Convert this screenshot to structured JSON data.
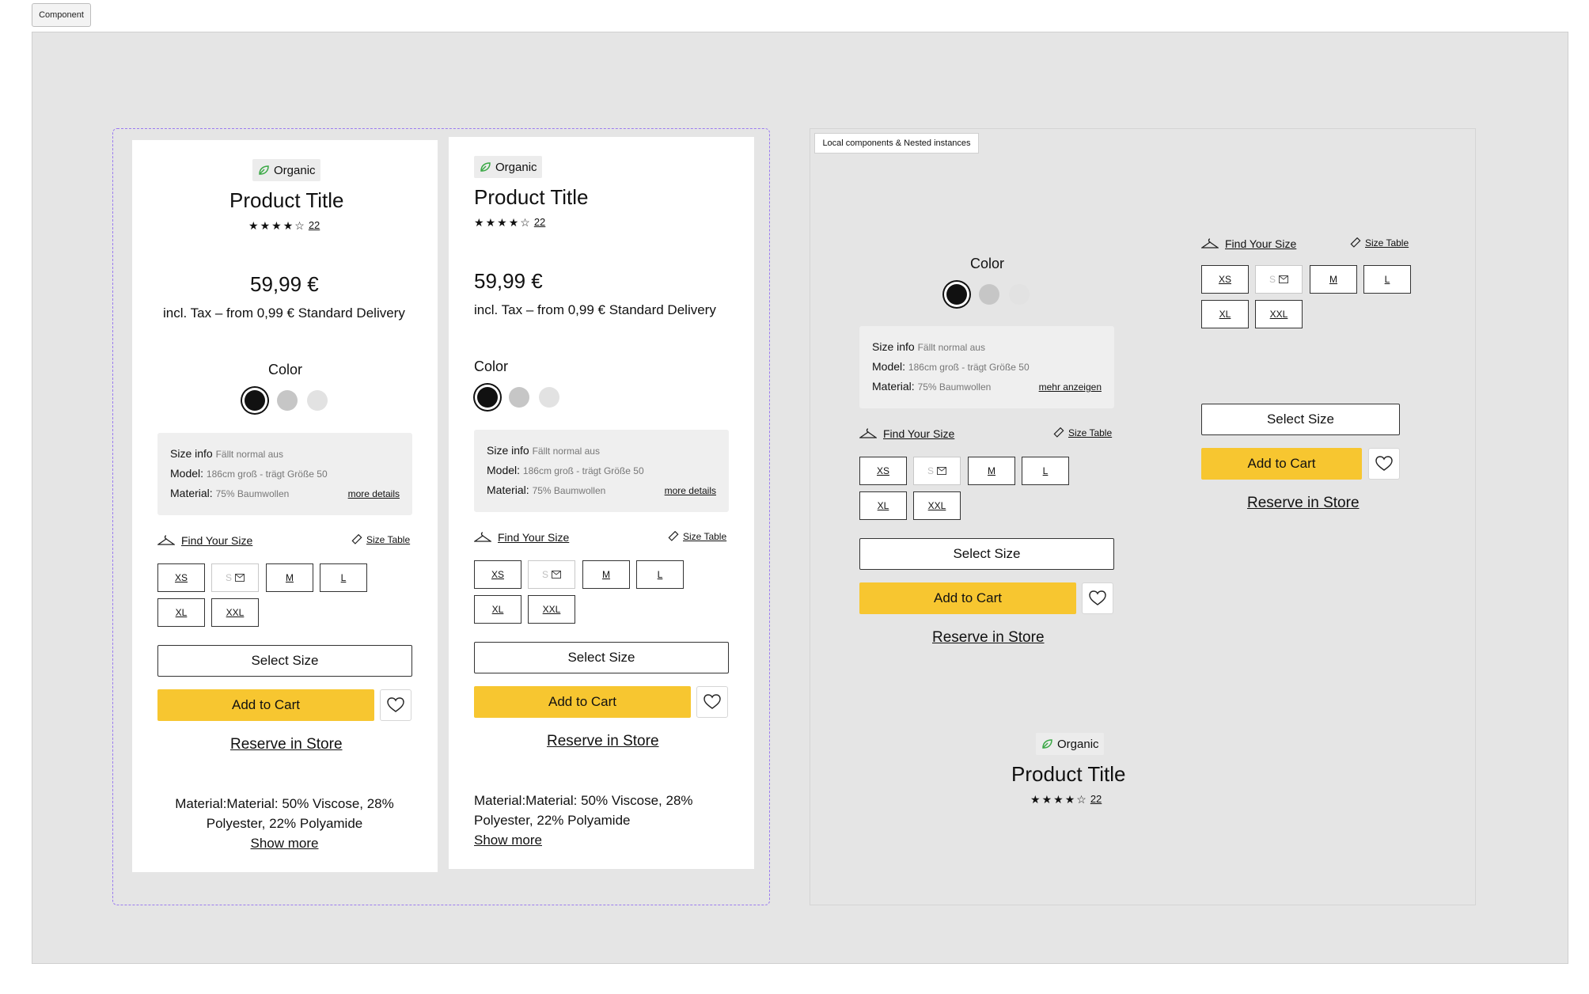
{
  "frame_label": "Component",
  "local_label": "Local components & Nested instances",
  "product": {
    "badge": "Organic",
    "title": "Product Title",
    "stars": [
      "★",
      "★",
      "★",
      "★",
      "☆"
    ],
    "rating_count": "22",
    "price": "59,99 €",
    "tax": "incl. Tax – from 0,99 €  Standard Delivery",
    "color_label": "Color",
    "size_info": {
      "label": "Size info",
      "label_sub": "Fällt normal aus",
      "model": "Model:",
      "model_sub": "186cm groß - trägt Größe 50",
      "material": "Material:",
      "material_sub": "75% Baumwollen",
      "more_details": "more details",
      "mehr": "mehr anzeigen"
    },
    "find_size": "Find Your Size",
    "size_table": "Size Table",
    "sizes": [
      "XS",
      "S",
      "M",
      "L",
      "XL",
      "XXL"
    ],
    "select_size": "Select Size",
    "add_to_cart": "Add to Cart",
    "reserve": "Reserve in Store",
    "material_text": "Material:Material: 50% Viscose, 28% Polyester, 22% Polyamide",
    "show_more": "Show more"
  },
  "colors": {
    "accent": "#f7c630",
    "selection": "#9b7cf0",
    "canvas": "#e5e5e5"
  }
}
